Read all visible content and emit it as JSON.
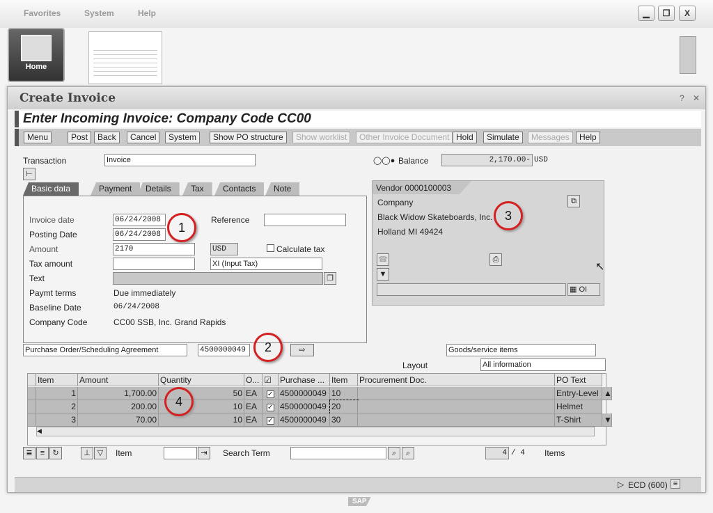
{
  "top_menu": [
    "Favorites",
    "System",
    "Help"
  ],
  "window_controls": {
    "minimize": "▁",
    "restore": "❐",
    "close": "X"
  },
  "home": {
    "label": "Home"
  },
  "window": {
    "title": "Create Invoice",
    "help": "?",
    "close": "✕"
  },
  "header": {
    "title": "Enter Incoming Invoice: Company Code CC00"
  },
  "toolbar": [
    {
      "label": "Menu",
      "enabled": true
    },
    {
      "label": "Post",
      "enabled": true
    },
    {
      "label": "Back",
      "enabled": true
    },
    {
      "label": "Cancel",
      "enabled": true
    },
    {
      "label": "System",
      "enabled": true
    },
    {
      "label": "Show PO structure",
      "enabled": true
    },
    {
      "label": "Show worklist",
      "enabled": false
    },
    {
      "label": "Other Invoice Document",
      "enabled": false
    },
    {
      "label": "Hold",
      "enabled": true
    },
    {
      "label": "Simulate",
      "enabled": true
    },
    {
      "label": "Messages",
      "enabled": false
    },
    {
      "label": "Help",
      "enabled": true
    }
  ],
  "transaction": {
    "label": "Transaction",
    "value": "Invoice"
  },
  "balance": {
    "label": "Balance",
    "value": "2,170.00-",
    "currency": "USD"
  },
  "tabs": [
    {
      "label": "Basic data",
      "active": true
    },
    {
      "label": "Payment"
    },
    {
      "label": "Details"
    },
    {
      "label": "Tax"
    },
    {
      "label": "Contacts"
    },
    {
      "label": "Note"
    }
  ],
  "basic": {
    "invoice_date": {
      "label": "Invoice date",
      "value": "06/24/2008"
    },
    "posting_date": {
      "label": "Posting Date",
      "value": "06/24/2008"
    },
    "reference": {
      "label": "Reference",
      "value": ""
    },
    "amount": {
      "label": "Amount",
      "value": "2170",
      "currency": "USD"
    },
    "calc_tax": {
      "label": "Calculate tax",
      "checked": false
    },
    "tax_amount": {
      "label": "Tax amount",
      "value": "",
      "tax_code": "XI (Input Tax)"
    },
    "text": {
      "label": "Text",
      "value": ""
    },
    "paymt_terms": {
      "label": "Paymt terms",
      "value": "Due immediately"
    },
    "baseline": {
      "label": "Baseline Date",
      "value": "06/24/2008"
    },
    "company_code": {
      "label": "Company Code",
      "value": "CC00 SSB, Inc. Grand Rapids"
    }
  },
  "vendor": {
    "title": "Vendor 0000100003",
    "line1": "Company",
    "line2": "Black Widow Skateboards, Inc.",
    "line3": "Holland MI  49424",
    "oi": "OI"
  },
  "reference_doc": {
    "type": "Purchase Order/Scheduling Agreement",
    "number": "4500000049"
  },
  "items_view": {
    "value": "Goods/service items",
    "layout_label": "Layout",
    "layout": "All information"
  },
  "callouts": [
    "1",
    "2",
    "3",
    "4"
  ],
  "table": {
    "columns": [
      "Item",
      "Amount",
      "Quantity",
      "O...",
      "",
      "Purchase ...",
      "Item",
      "Procurement Doc.",
      "PO Text"
    ],
    "rows": [
      {
        "item": "1",
        "amount": "1,700.00",
        "qty": "50",
        "unit": "EA",
        "checked": true,
        "po": "4500000049",
        "po_item": "10",
        "proc": "",
        "text": "Entry-Level S"
      },
      {
        "item": "2",
        "amount": "200.00",
        "qty": "10",
        "unit": "EA",
        "checked": true,
        "po": "4500000049",
        "po_item": "20",
        "proc": "",
        "text": "Helmet"
      },
      {
        "item": "3",
        "amount": "70.00",
        "qty": "10",
        "unit": "EA",
        "checked": true,
        "po": "4500000049",
        "po_item": "30",
        "proc": "",
        "text": "T-Shirt"
      }
    ]
  },
  "bottom": {
    "item_label": "Item",
    "search_label": "Search Term",
    "count": "4",
    "total": "4",
    "items_label": "Items"
  },
  "status": {
    "system": "ECD (600)"
  },
  "brand": "SAP"
}
